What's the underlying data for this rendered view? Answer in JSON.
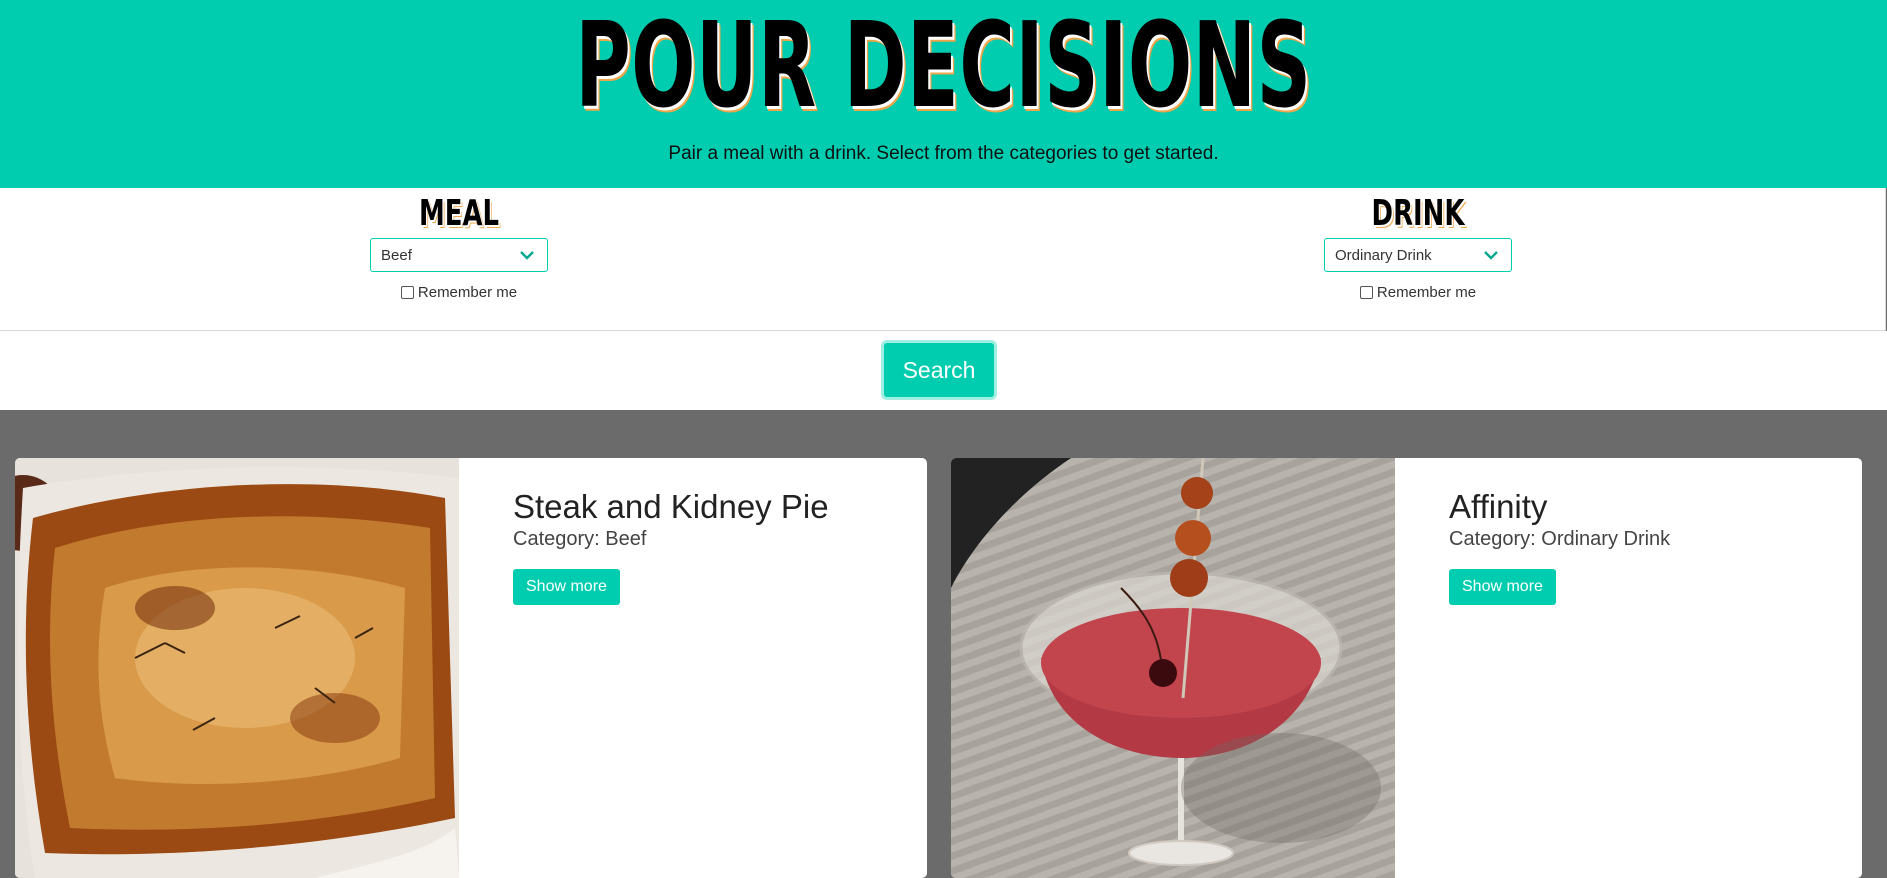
{
  "header": {
    "title": "POUR DECISIONS",
    "subtitle": "Pair a meal with a drink. Select from the categories to get started."
  },
  "meal_selector": {
    "heading": "MEAL",
    "selected": "Beef",
    "remember_label": "Remember me"
  },
  "drink_selector": {
    "heading": "DRINK",
    "selected": "Ordinary Drink",
    "remember_label": "Remember me"
  },
  "search": {
    "label": "Search"
  },
  "meal_card": {
    "title": "Steak and Kidney Pie",
    "category": "Category: Beef",
    "button": "Show more"
  },
  "drink_card": {
    "title": "Affinity",
    "category": "Category: Ordinary Drink",
    "button": "Show more"
  },
  "colors": {
    "accent": "#00cdb0",
    "results_background": "#6b6b6b",
    "heading_shadow": "#f0a54a"
  },
  "icons": {
    "select_arrow": "chevron-down-icon",
    "checkbox": "checkbox-icon"
  }
}
